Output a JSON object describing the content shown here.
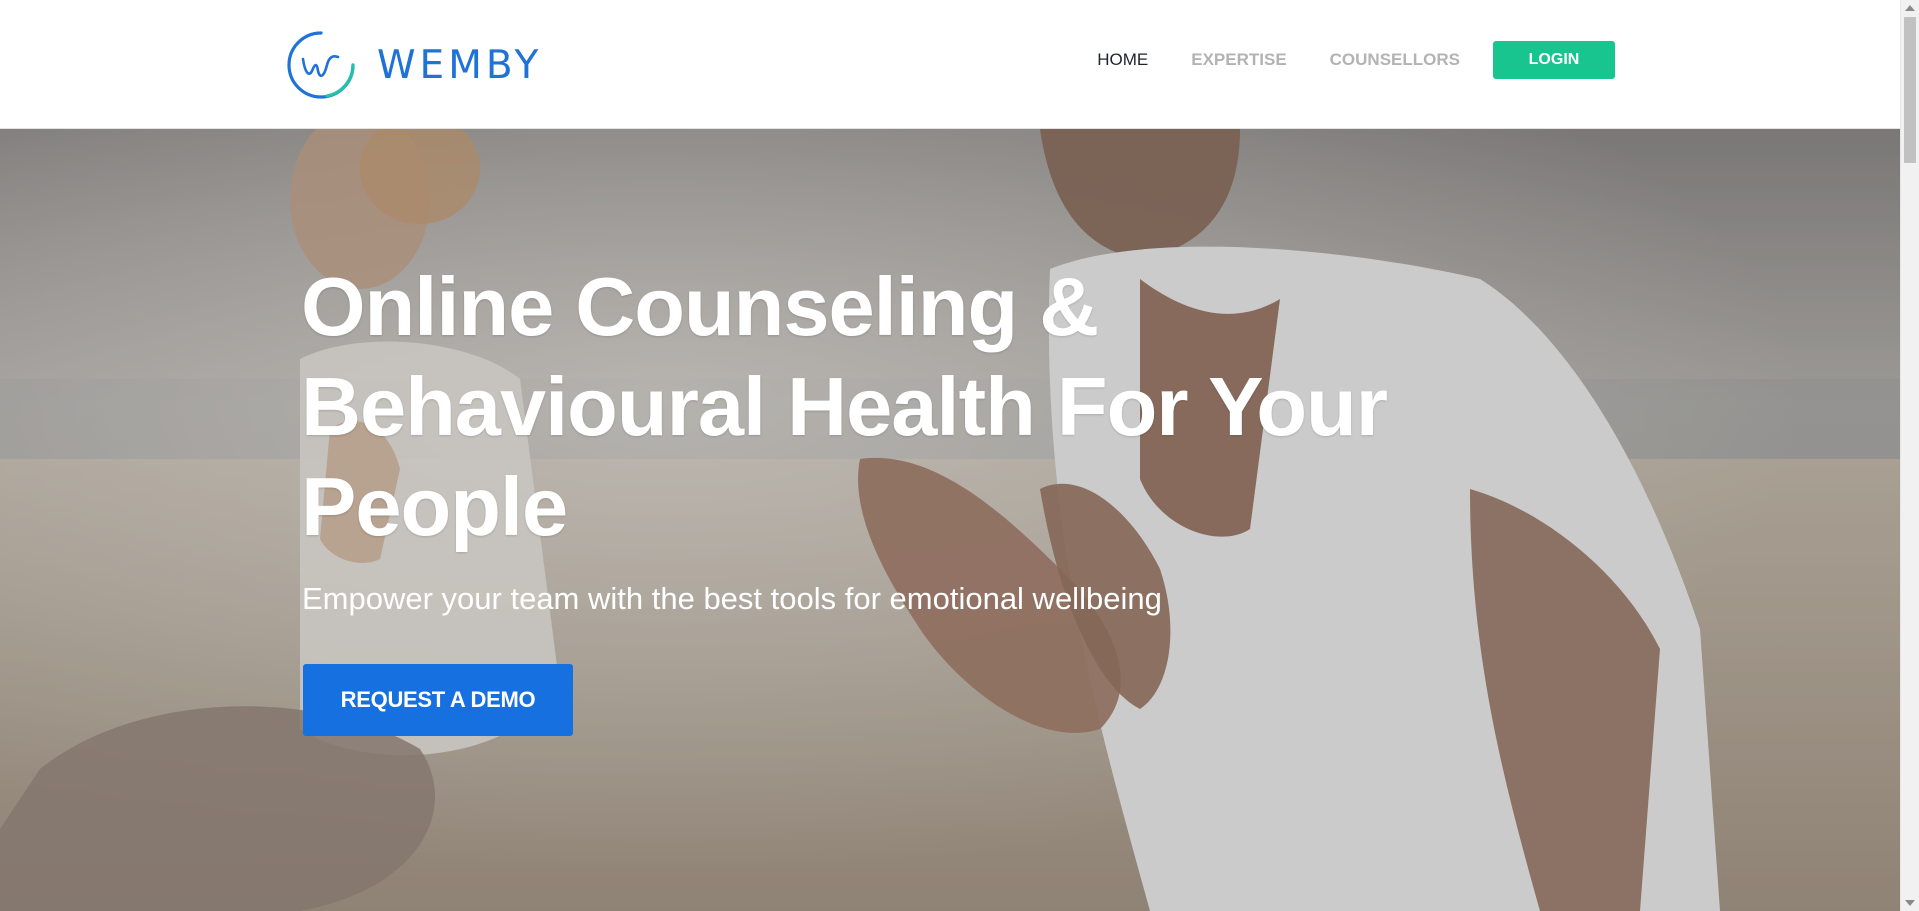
{
  "brand": {
    "name": "WEMBY",
    "logo_icon": "wemby-logo-icon",
    "colors": {
      "blue": "#1f72d6",
      "teal": "#21c2a8"
    }
  },
  "nav": {
    "items": [
      {
        "label": "HOME",
        "active": true
      },
      {
        "label": "EXPERTISE",
        "active": false
      },
      {
        "label": "COUNSELLORS",
        "active": false
      }
    ],
    "login_label": "LOGIN"
  },
  "hero": {
    "title": "Online Counseling & Behavioural Health For Your People",
    "subtitle": "Empower your team with the best tools for emotional wellbeing",
    "cta_label": "REQUEST A DEMO",
    "background_icon": "meditation-photo"
  },
  "colors": {
    "accent_green": "#19c58f",
    "cta_blue": "#1770e0",
    "nav_active": "#1d2330",
    "nav_inactive": "#b3b3b3"
  }
}
